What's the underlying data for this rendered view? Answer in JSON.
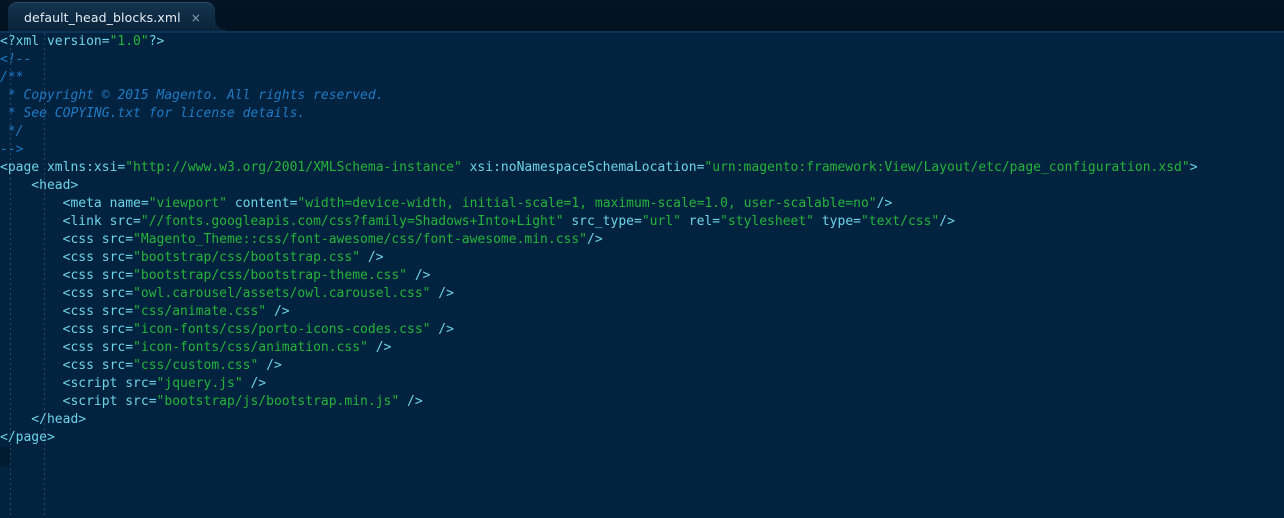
{
  "window": {
    "app": "code-editor",
    "background_color": "#02233f",
    "tabbar_color": "#01121f"
  },
  "tabbar": {
    "tabs": [
      {
        "title": "default_head_blocks.xml",
        "close_label": "×",
        "active": true
      }
    ]
  },
  "editor": {
    "language": "xml",
    "indent_guides": [
      10,
      44
    ],
    "colors": {
      "tag": "#6ed3e8",
      "string": "#25b33a",
      "comment": "#1f79c4",
      "text": "#cfe2ef"
    },
    "lines": [
      [
        {
          "t": "<?xml version=",
          "c": "tag"
        },
        {
          "t": "\"1.0\"",
          "c": "str"
        },
        {
          "t": "?>",
          "c": "tag"
        }
      ],
      [
        {
          "t": "<!--",
          "c": "com"
        }
      ],
      [
        {
          "t": "/**",
          "c": "com"
        }
      ],
      [
        {
          "t": " * Copyright © 2015 Magento. All rights reserved.",
          "c": "com"
        }
      ],
      [
        {
          "t": " * See COPYING.txt for license details.",
          "c": "com"
        }
      ],
      [
        {
          "t": " */",
          "c": "com"
        }
      ],
      [
        {
          "t": "-->",
          "c": "com"
        }
      ],
      [
        {
          "t": "<page xmlns:xsi=",
          "c": "tag"
        },
        {
          "t": "\"http://www.w3.org/2001/XMLSchema-instance\"",
          "c": "str"
        },
        {
          "t": " xsi:noNamespaceSchemaLocation=",
          "c": "tag"
        },
        {
          "t": "\"urn:magento:framework:View/Layout/etc/page_configuration.xsd\"",
          "c": "str"
        },
        {
          "t": ">",
          "c": "tag"
        }
      ],
      [
        {
          "t": "    <head>",
          "c": "tag"
        }
      ],
      [
        {
          "t": "        <meta name=",
          "c": "tag"
        },
        {
          "t": "\"viewport\"",
          "c": "str"
        },
        {
          "t": " content=",
          "c": "tag"
        },
        {
          "t": "\"width=device-width, initial-scale=1, maximum-scale=1.0, user-scalable=no\"",
          "c": "str"
        },
        {
          "t": "/>",
          "c": "tag"
        }
      ],
      [
        {
          "t": "        <link src=",
          "c": "tag"
        },
        {
          "t": "\"//fonts.googleapis.com/css?family=Shadows+Into+Light\"",
          "c": "str"
        },
        {
          "t": " src_type=",
          "c": "tag"
        },
        {
          "t": "\"url\"",
          "c": "str"
        },
        {
          "t": " rel=",
          "c": "tag"
        },
        {
          "t": "\"stylesheet\"",
          "c": "str"
        },
        {
          "t": " type=",
          "c": "tag"
        },
        {
          "t": "\"text/css\"",
          "c": "str"
        },
        {
          "t": "/>",
          "c": "tag"
        }
      ],
      [
        {
          "t": "        <css src=",
          "c": "tag"
        },
        {
          "t": "\"Magento_Theme::css/font-awesome/css/font-awesome.min.css\"",
          "c": "str"
        },
        {
          "t": "/>",
          "c": "tag"
        }
      ],
      [
        {
          "t": "        <css src=",
          "c": "tag"
        },
        {
          "t": "\"bootstrap/css/bootstrap.css\"",
          "c": "str"
        },
        {
          "t": " />",
          "c": "tag"
        }
      ],
      [
        {
          "t": "        <css src=",
          "c": "tag"
        },
        {
          "t": "\"bootstrap/css/bootstrap-theme.css\"",
          "c": "str"
        },
        {
          "t": " />",
          "c": "tag"
        }
      ],
      [
        {
          "t": "        <css src=",
          "c": "tag"
        },
        {
          "t": "\"owl.carousel/assets/owl.carousel.css\"",
          "c": "str"
        },
        {
          "t": " />",
          "c": "tag"
        }
      ],
      [
        {
          "t": "        <css src=",
          "c": "tag"
        },
        {
          "t": "\"css/animate.css\"",
          "c": "str"
        },
        {
          "t": " />",
          "c": "tag"
        }
      ],
      [
        {
          "t": "        <css src=",
          "c": "tag"
        },
        {
          "t": "\"icon-fonts/css/porto-icons-codes.css\"",
          "c": "str"
        },
        {
          "t": " />",
          "c": "tag"
        }
      ],
      [
        {
          "t": "        <css src=",
          "c": "tag"
        },
        {
          "t": "\"icon-fonts/css/animation.css\"",
          "c": "str"
        },
        {
          "t": " />",
          "c": "tag"
        }
      ],
      [
        {
          "t": "        <css src=",
          "c": "tag"
        },
        {
          "t": "\"css/custom.css\"",
          "c": "str"
        },
        {
          "t": " />",
          "c": "tag"
        }
      ],
      [
        {
          "t": "        <script src=",
          "c": "tag"
        },
        {
          "t": "\"jquery.js\"",
          "c": "str"
        },
        {
          "t": " />",
          "c": "tag"
        }
      ],
      [
        {
          "t": "        <script src=",
          "c": "tag"
        },
        {
          "t": "\"bootstrap/js/bootstrap.min.js\"",
          "c": "str"
        },
        {
          "t": " />",
          "c": "tag"
        }
      ],
      [
        {
          "t": "    </head>",
          "c": "tag"
        }
      ],
      [
        {
          "t": "</page>",
          "c": "tag"
        }
      ]
    ]
  }
}
